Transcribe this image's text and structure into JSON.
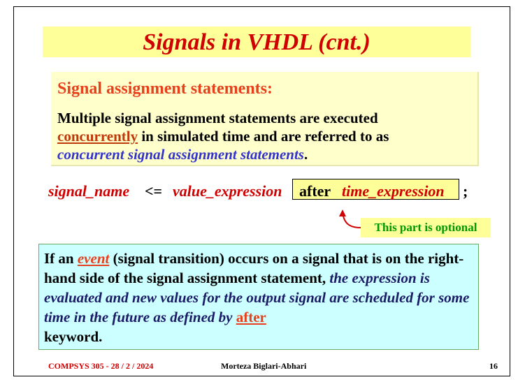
{
  "title": "Signals in VHDL (cnt.)",
  "box1": {
    "heading": "Signal assignment statements:",
    "line1": "Multiple signal assignment statements are executed",
    "concurrently": "concurrently",
    "line2_rest": " in simulated time and are referred to as",
    "italic_term": "concurrent signal assignment statements",
    "period": "."
  },
  "statement": {
    "signal_name": "signal_name",
    "op": "<=",
    "value_expression": "value_expression",
    "after": "after",
    "time_expression": "time_expression",
    "semicolon": ";"
  },
  "note": "This part is optional",
  "box2": {
    "if_an": "If an ",
    "event": "event",
    "part1": " (signal transition) occurs on a signal that is on the right-hand side of the signal assignment statement, ",
    "italic_part": "the expression is evaluated and new values for the output signal are scheduled for some time in the future as defined by ",
    "after": "after",
    "keyword": "keyword."
  },
  "footer": {
    "left": "COMPSYS 305 -  28 / 2 / 2024",
    "center": "Morteza Biglari-Abhari",
    "page": "16"
  },
  "colors": {
    "title": "#d00000",
    "title_bg": "#ffff99",
    "box1_bg": "#ffffcc",
    "box2_bg": "#ccffff",
    "note_text": "#009900"
  }
}
